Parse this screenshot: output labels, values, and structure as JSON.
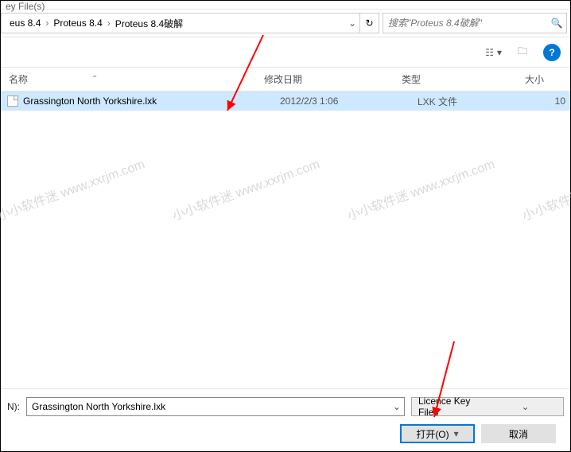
{
  "title_fragment": "ey File(s)",
  "breadcrumbs": [
    "eus 8.4",
    "Proteus 8.4",
    "Proteus 8.4破解"
  ],
  "search": {
    "placeholder": "搜索\"Proteus 8.4破解\""
  },
  "columns": {
    "name": "名称",
    "date": "修改日期",
    "type": "类型",
    "size": "大小"
  },
  "file": {
    "name": "Grassington North Yorkshire.lxk",
    "date": "2012/2/3 1:06",
    "type": "LXK 文件",
    "size": "10"
  },
  "watermark": "小小软件迷 www.xxrjm.com",
  "bottom": {
    "label_fragment": "N):",
    "filename": "Grassington North Yorkshire.lxk",
    "filter": "Licence Key Files",
    "open": "打开(O)",
    "cancel": "取消"
  }
}
